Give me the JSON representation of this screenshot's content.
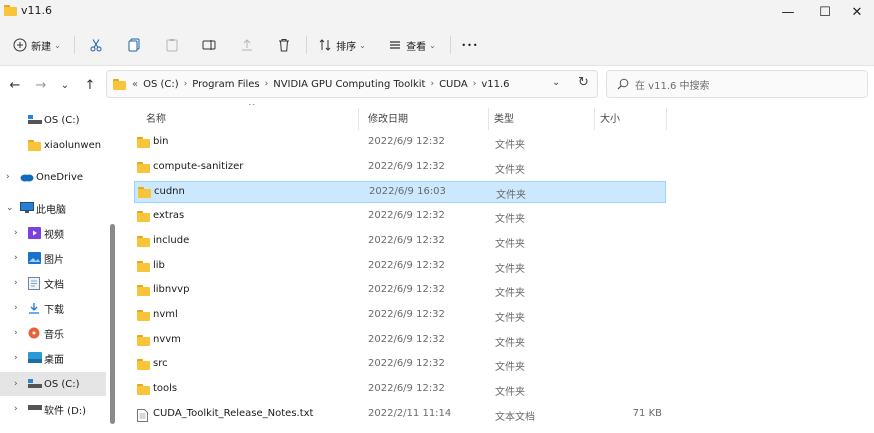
{
  "window": {
    "title": "v11.6",
    "minimize_glyph": "—",
    "maximize_glyph": "☐",
    "close_glyph": "✕"
  },
  "toolbar": {
    "new_label": "新建",
    "sort_label": "排序",
    "view_label": "查看",
    "more_glyph": "•••"
  },
  "nav": {
    "back_glyph": "←",
    "forward_glyph": "→",
    "recent_glyph": "⌄",
    "up_glyph": "↑"
  },
  "address": {
    "overflow": "«",
    "crumbs": [
      "OS (C:)",
      "Program Files",
      "NVIDIA GPU Computing Toolkit",
      "CUDA",
      "v11.6"
    ],
    "separator": "›",
    "dropdown_glyph": "⌄",
    "refresh_glyph": "↻"
  },
  "search": {
    "placeholder": "在 v11.6 中搜索"
  },
  "sidebar": {
    "items": [
      {
        "label": "OS (C:)",
        "icon": "drive-icon"
      },
      {
        "label": "xiaolunwen",
        "icon": "folder-icon"
      },
      {
        "label": "OneDrive",
        "icon": "cloud-icon"
      },
      {
        "label": "此电脑",
        "icon": "computer-icon"
      },
      {
        "label": "视频",
        "icon": "video-icon"
      },
      {
        "label": "图片",
        "icon": "pictures-icon"
      },
      {
        "label": "文档",
        "icon": "documents-icon"
      },
      {
        "label": "下载",
        "icon": "download-icon"
      },
      {
        "label": "音乐",
        "icon": "music-icon"
      },
      {
        "label": "桌面",
        "icon": "desktop-icon"
      },
      {
        "label": "OS (C:)",
        "icon": "drive-icon"
      },
      {
        "label": "软件 (D:)",
        "icon": "drive-icon"
      }
    ]
  },
  "columns": {
    "name": "名称",
    "date": "修改日期",
    "type": "类型",
    "size": "大小"
  },
  "files": [
    {
      "name": "bin",
      "date": "2022/6/9 12:32",
      "type": "文件夹",
      "size": "",
      "kind": "folder"
    },
    {
      "name": "compute-sanitizer",
      "date": "2022/6/9 12:32",
      "type": "文件夹",
      "size": "",
      "kind": "folder"
    },
    {
      "name": "cudnn",
      "date": "2022/6/9 16:03",
      "type": "文件夹",
      "size": "",
      "kind": "folder",
      "selected": true
    },
    {
      "name": "extras",
      "date": "2022/6/9 12:32",
      "type": "文件夹",
      "size": "",
      "kind": "folder"
    },
    {
      "name": "include",
      "date": "2022/6/9 12:32",
      "type": "文件夹",
      "size": "",
      "kind": "folder"
    },
    {
      "name": "lib",
      "date": "2022/6/9 12:32",
      "type": "文件夹",
      "size": "",
      "kind": "folder"
    },
    {
      "name": "libnvvp",
      "date": "2022/6/9 12:32",
      "type": "文件夹",
      "size": "",
      "kind": "folder"
    },
    {
      "name": "nvml",
      "date": "2022/6/9 12:32",
      "type": "文件夹",
      "size": "",
      "kind": "folder"
    },
    {
      "name": "nvvm",
      "date": "2022/6/9 12:32",
      "type": "文件夹",
      "size": "",
      "kind": "folder"
    },
    {
      "name": "src",
      "date": "2022/6/9 12:32",
      "type": "文件夹",
      "size": "",
      "kind": "folder"
    },
    {
      "name": "tools",
      "date": "2022/6/9 12:32",
      "type": "文件夹",
      "size": "",
      "kind": "folder"
    },
    {
      "name": "CUDA_Toolkit_Release_Notes.txt",
      "date": "2022/2/11 11:14",
      "type": "文本文档",
      "size": "71 KB",
      "kind": "text"
    }
  ],
  "colors": {
    "selection_bg": "#cce8ff",
    "selection_border": "#99d1ff",
    "folder": "#f8c53a",
    "accent": "#0067c0"
  }
}
